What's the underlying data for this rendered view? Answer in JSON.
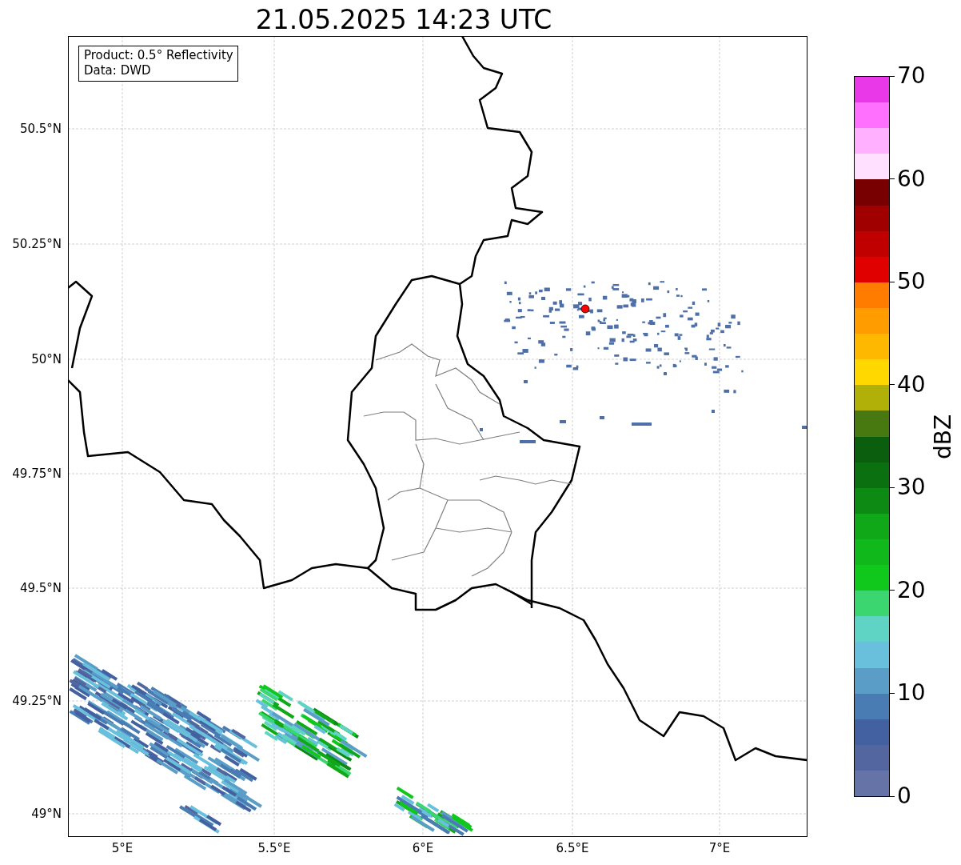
{
  "title": "21.05.2025 14:23 UTC",
  "map": {
    "info_box": [
      "Product: 0.5° Reflectivity",
      "Data: DWD"
    ],
    "lat_labels": [
      "50.5°N",
      "50.25°N",
      "50°N",
      "49.75°N",
      "49.5°N",
      "49.25°N",
      "49°N"
    ],
    "lon_labels": [
      "5°E",
      "5.5°E",
      "6°E",
      "6.5°E",
      "7°E"
    ]
  },
  "colorbar": {
    "label": "dBZ",
    "ticks": [
      "70",
      "60",
      "50",
      "40",
      "30",
      "20",
      "10",
      "0"
    ],
    "segments": [
      {
        "color": "#e838e8"
      },
      {
        "color": "#ff70ff"
      },
      {
        "color": "#ffb0ff"
      },
      {
        "color": "#ffe0ff"
      },
      {
        "color": "#780000"
      },
      {
        "color": "#a00000"
      },
      {
        "color": "#c00000"
      },
      {
        "color": "#e00000"
      },
      {
        "color": "#ff7c00"
      },
      {
        "color": "#ff9c00"
      },
      {
        "color": "#ffb800"
      },
      {
        "color": "#ffd800"
      },
      {
        "color": "#b0b008"
      },
      {
        "color": "#487810"
      },
      {
        "color": "#0a5e0e"
      },
      {
        "color": "#0a7010"
      },
      {
        "color": "#0c8a14"
      },
      {
        "color": "#10a818"
      },
      {
        "color": "#10b81c"
      },
      {
        "color": "#10c81c"
      },
      {
        "color": "#3cd670"
      },
      {
        "color": "#60d4c4"
      },
      {
        "color": "#68c0dc"
      },
      {
        "color": "#5a9ec8"
      },
      {
        "color": "#4a7cb4"
      },
      {
        "color": "#4360a0"
      },
      {
        "color": "#5366a0"
      },
      {
        "color": "#6673a6"
      }
    ]
  }
}
